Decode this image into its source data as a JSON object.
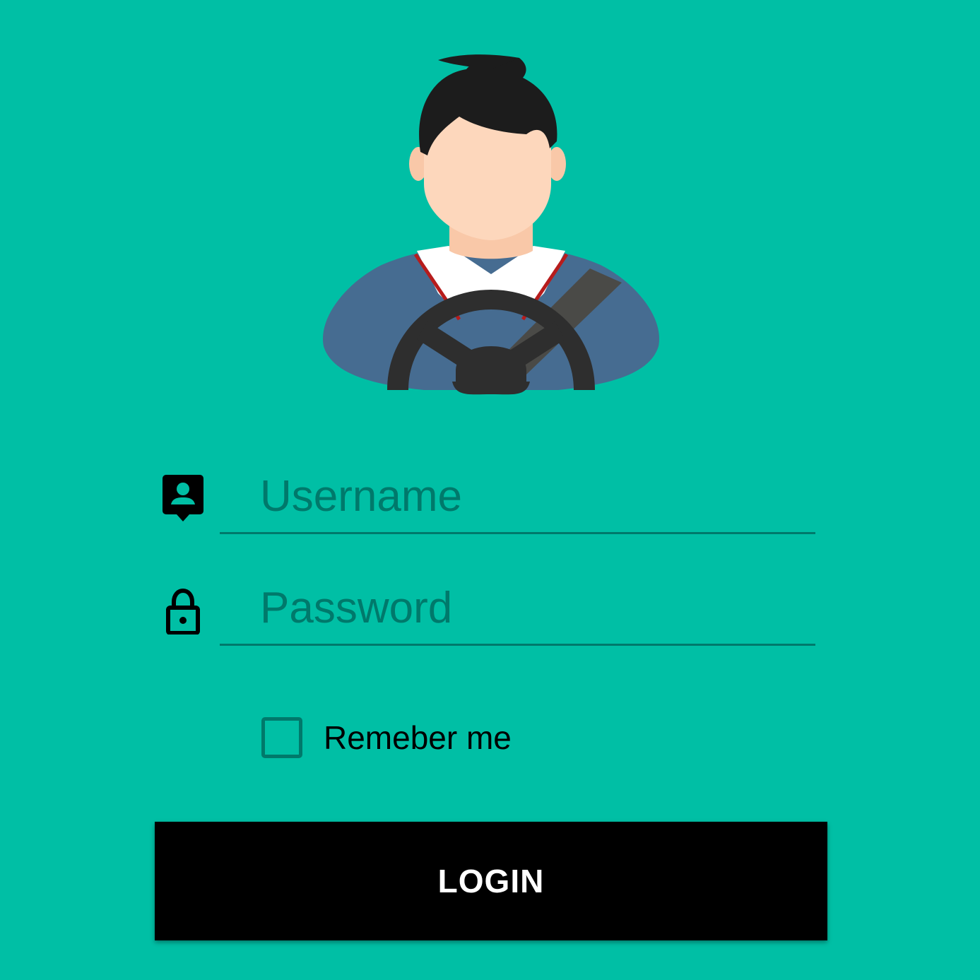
{
  "app": {
    "background_color": "#00bfa5",
    "accent_color": "#00796b"
  },
  "avatar": {
    "icon": "driver-avatar"
  },
  "username": {
    "icon": "account-box-icon",
    "placeholder": "Username",
    "value": ""
  },
  "password": {
    "icon": "lock-icon",
    "placeholder": "Password",
    "value": ""
  },
  "remember": {
    "label": "Remeber me",
    "checked": false
  },
  "login": {
    "label": "LOGIN"
  }
}
